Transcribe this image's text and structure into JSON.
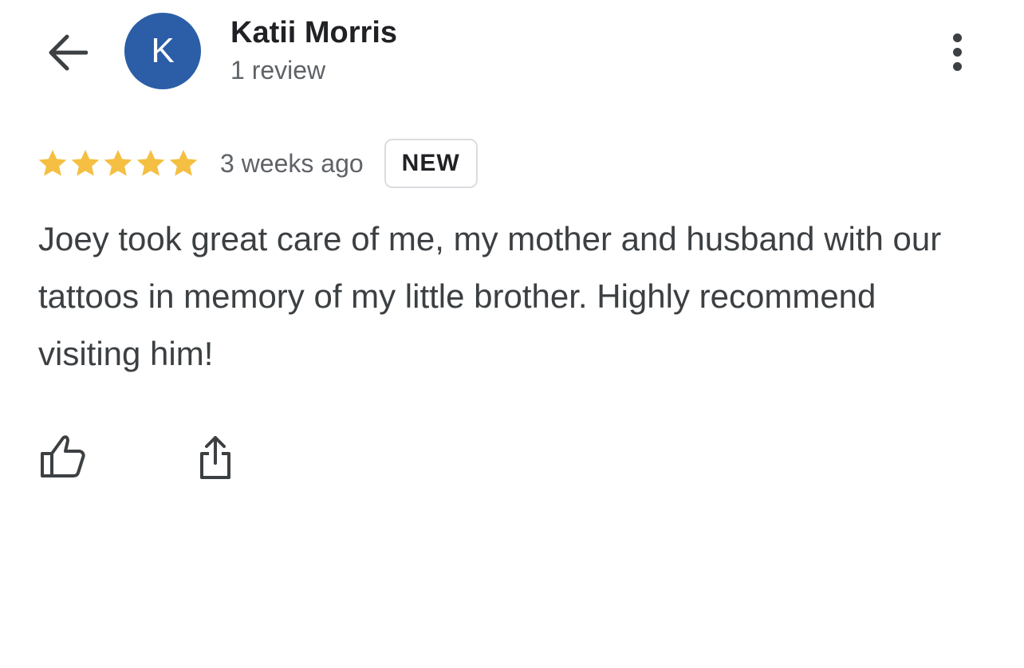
{
  "header": {
    "back_icon": "arrow-back-icon",
    "avatar_letter": "K",
    "avatar_color": "#2b5ea7",
    "reviewer_name": "Katii Morris",
    "review_count": "1 review",
    "more_icon": "more-vert-icon"
  },
  "review": {
    "rating": 5,
    "max_rating": 5,
    "star_color": "#f4bf42",
    "time_ago": "3 weeks ago",
    "badge": "NEW",
    "text": "Joey took great care of me, my mother and husband with our tattoos in memory of my little brother. Highly recommend visiting him!"
  },
  "actions": {
    "like_icon": "thumbs-up-icon",
    "share_icon": "share-icon"
  }
}
